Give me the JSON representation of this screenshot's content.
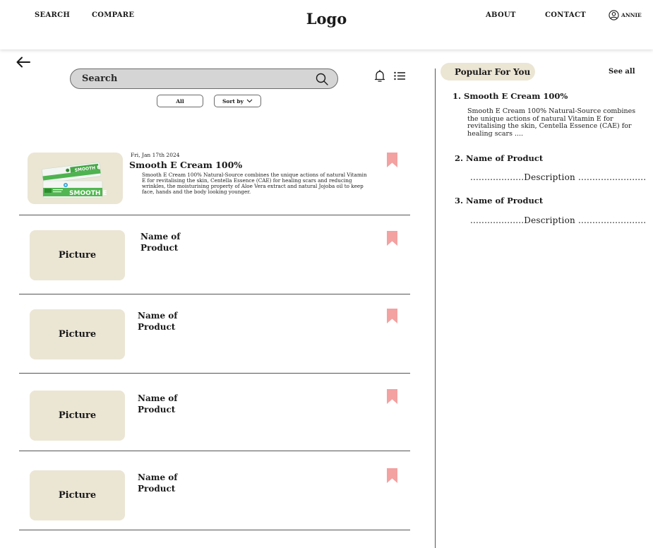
{
  "header": {
    "nav_search": "SEARCH",
    "nav_compare": "COMPARE",
    "logo": "Logo",
    "nav_about": "ABOUT",
    "nav_contact": "CONTACT",
    "user_name": "ANNIE"
  },
  "search": {
    "placeholder": "Search",
    "filter_all": "All",
    "sort_by": "Sort by"
  },
  "products": {
    "featured": {
      "date": "Fri, Jan 17th 2024",
      "title": "Smooth E Cream 100%",
      "description": "Smooth E Cream 100% Natural-Source combines the unique actions of natural Vitamin E for revitalising the skin, Centella Essence (CAE) for healing scars and reducing wrinkles, the moisturising property of Aloe Vera extract and natural Jojoba oil to keep face, hands and the body looking younger.",
      "image_text": "SMOOTH E"
    },
    "placeholders": [
      {
        "picture_label": "Picture",
        "name": "Name of Product"
      },
      {
        "picture_label": "Picture",
        "name": "Name of Product"
      },
      {
        "picture_label": "Picture",
        "name": "Name of Product"
      },
      {
        "picture_label": "Picture",
        "name": "Name of Product"
      }
    ]
  },
  "popular": {
    "heading": "Popular For You",
    "see_all": "See all",
    "items": [
      {
        "title": "1. Smooth E Cream 100%",
        "description": "Smooth E Cream 100% Natural-Source combines the unique actions of natural Vitamin E for revitalising the skin, Centella Essence (CAE) for healing scars ...."
      },
      {
        "title": "2. Name of Product",
        "description": "...................Description ........................"
      },
      {
        "title": "3. Name of Product",
        "description": "...................Description ........................"
      }
    ]
  },
  "icons": {
    "back": "arrow-left-icon",
    "search": "search-icon",
    "bell": "bell-icon",
    "list": "list-icon",
    "bookmark": "bookmark-icon",
    "user": "user-circle-icon",
    "chevron": "chevron-down-icon"
  },
  "colors": {
    "accent_bookmark": "#f3a1a1",
    "chip_bg": "#ebe5d4",
    "search_bg": "#d5d5d5"
  }
}
